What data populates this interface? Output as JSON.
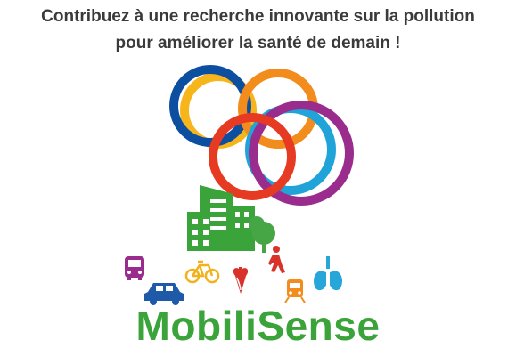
{
  "headline": {
    "line1": "Contribuez à une recherche innovante sur la pollution",
    "line2": "pour améliorer la santé de demain !"
  },
  "brand": {
    "name": "MobiliSense",
    "color": "#3aa33a"
  },
  "colors": {
    "ring_navy": "#0c4ea0",
    "ring_yellow": "#f6b51a",
    "ring_orange": "#f28c1c",
    "ring_cyan": "#1fa3d8",
    "ring_purple": "#9a2c8e",
    "ring_red": "#e63a22",
    "building_green": "#3aa33a",
    "tree_green": "#46a646",
    "icon_purple": "#9a2c8e",
    "icon_blue": "#1f5aa8",
    "icon_yellow": "#f2b21b",
    "icon_red": "#d9322b",
    "icon_orange": "#f28c1c",
    "icon_cyan": "#27a6d9"
  },
  "icons": [
    "bus-icon",
    "car-icon",
    "bicycle-icon",
    "heart-icon",
    "pedestrian-icon",
    "train-icon",
    "lungs-icon",
    "building-icon",
    "tree-icon"
  ]
}
